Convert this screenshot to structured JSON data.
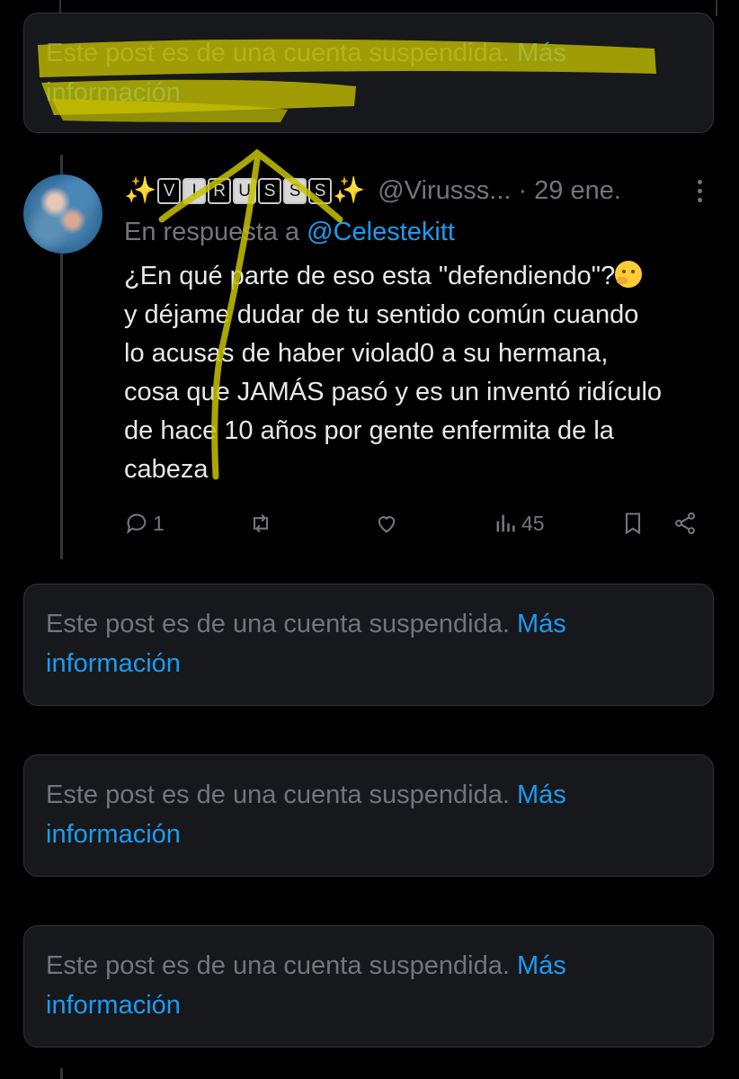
{
  "suspended_posts": [
    {
      "text": "Este post es de una cuenta suspendida.",
      "link": "Más información"
    },
    {
      "text": "Este post es de una cuenta suspendida.",
      "link": "Más información"
    },
    {
      "text": "Este post es de una cuenta suspendida.",
      "link": "Más información"
    },
    {
      "text": "Este post es de una cuenta suspendida.",
      "link": "Más información"
    }
  ],
  "tweet": {
    "name_sparkle": "✨",
    "name_letters": [
      "V",
      "I",
      "R",
      "U",
      "S",
      "S",
      "S"
    ],
    "handle": "@Virusss...",
    "time": "· 29 ene.",
    "reply_prefix": "En respuesta a",
    "reply_mention": "@Celestekitt",
    "text_part1": "¿En qué parte de eso esta \"defendiendo\"?",
    "text_part2": "y déjame dudar de tu sentido común cuando\nlo acusas de haber violad0 a su hermana,\ncosa que JAMÁS pasó y es un inventó ridículo\nde hace 10 años por gente enfermita de la\ncabeza",
    "reply_count": "1",
    "view_count": "45",
    "emoji": "thinking-face"
  },
  "icons": {
    "reply": "reply-icon",
    "repost": "repost-icon",
    "like": "like-icon",
    "views": "views-icon",
    "bookmark": "bookmark-icon",
    "share": "share-icon",
    "more": "more-icon"
  },
  "colors": {
    "background": "#000000",
    "card": "#16181c",
    "link": "#1d9bf0",
    "muted": "#71767b",
    "text": "#e7e9ea",
    "highlight": "#c8c200"
  }
}
